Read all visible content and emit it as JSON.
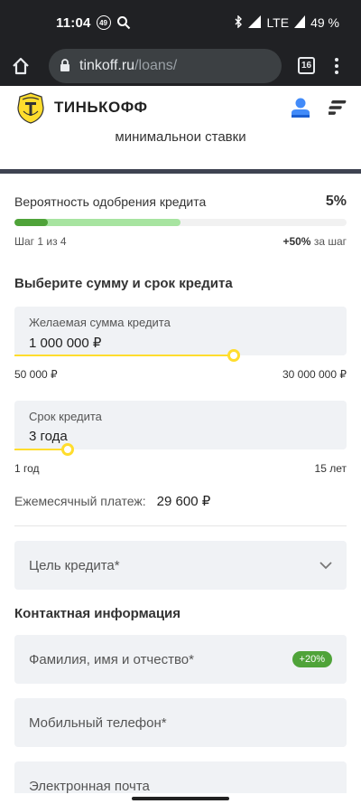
{
  "status": {
    "time": "11:04",
    "notif_count": "49",
    "network": "LTE",
    "battery": "49 %"
  },
  "browser": {
    "url_host": "tinkoff.ru",
    "url_path": "/loans/",
    "tab_count": "16"
  },
  "header": {
    "brand": "ТИНЬКОФФ"
  },
  "cutoff_text": "минимальнои ставки",
  "approval": {
    "label": "Вероятность одобрения кредита",
    "value": "5%",
    "progress_fraction": 0.05,
    "step_text": "Шаг 1 из 4",
    "bonus_value": "+50%",
    "bonus_suffix": "за шаг"
  },
  "loan": {
    "section_title": "Выберите сумму и срок кредита",
    "amount_label": "Желаемая сумма кредита",
    "amount_value": "1 000 000 ₽",
    "amount_min": "50 000 ₽",
    "amount_max": "30 000 000 ₽",
    "term_label": "Срок кредита",
    "term_value": "3 года",
    "term_min": "1 год",
    "term_max": "15 лет",
    "payment_label": "Ежемесячный платеж:",
    "payment_value": "29 600 ₽",
    "purpose_placeholder": "Цель кредита*"
  },
  "contact": {
    "section_title": "Контактная информация",
    "fullname_placeholder": "Фамилия, имя и отчество*",
    "fullname_badge": "+20%",
    "phone_placeholder": "Мобильный телефон*",
    "email_placeholder": "Электронная почта"
  },
  "colors": {
    "accent_yellow": "#ffdd2d",
    "success_green": "#4fa339",
    "field_bg": "#f0f2f5"
  },
  "icons": {
    "home": "home-icon",
    "lock": "lock-icon",
    "profile": "profile-icon",
    "menu": "hamburger-icon",
    "chevron": "chevron-down-icon"
  }
}
